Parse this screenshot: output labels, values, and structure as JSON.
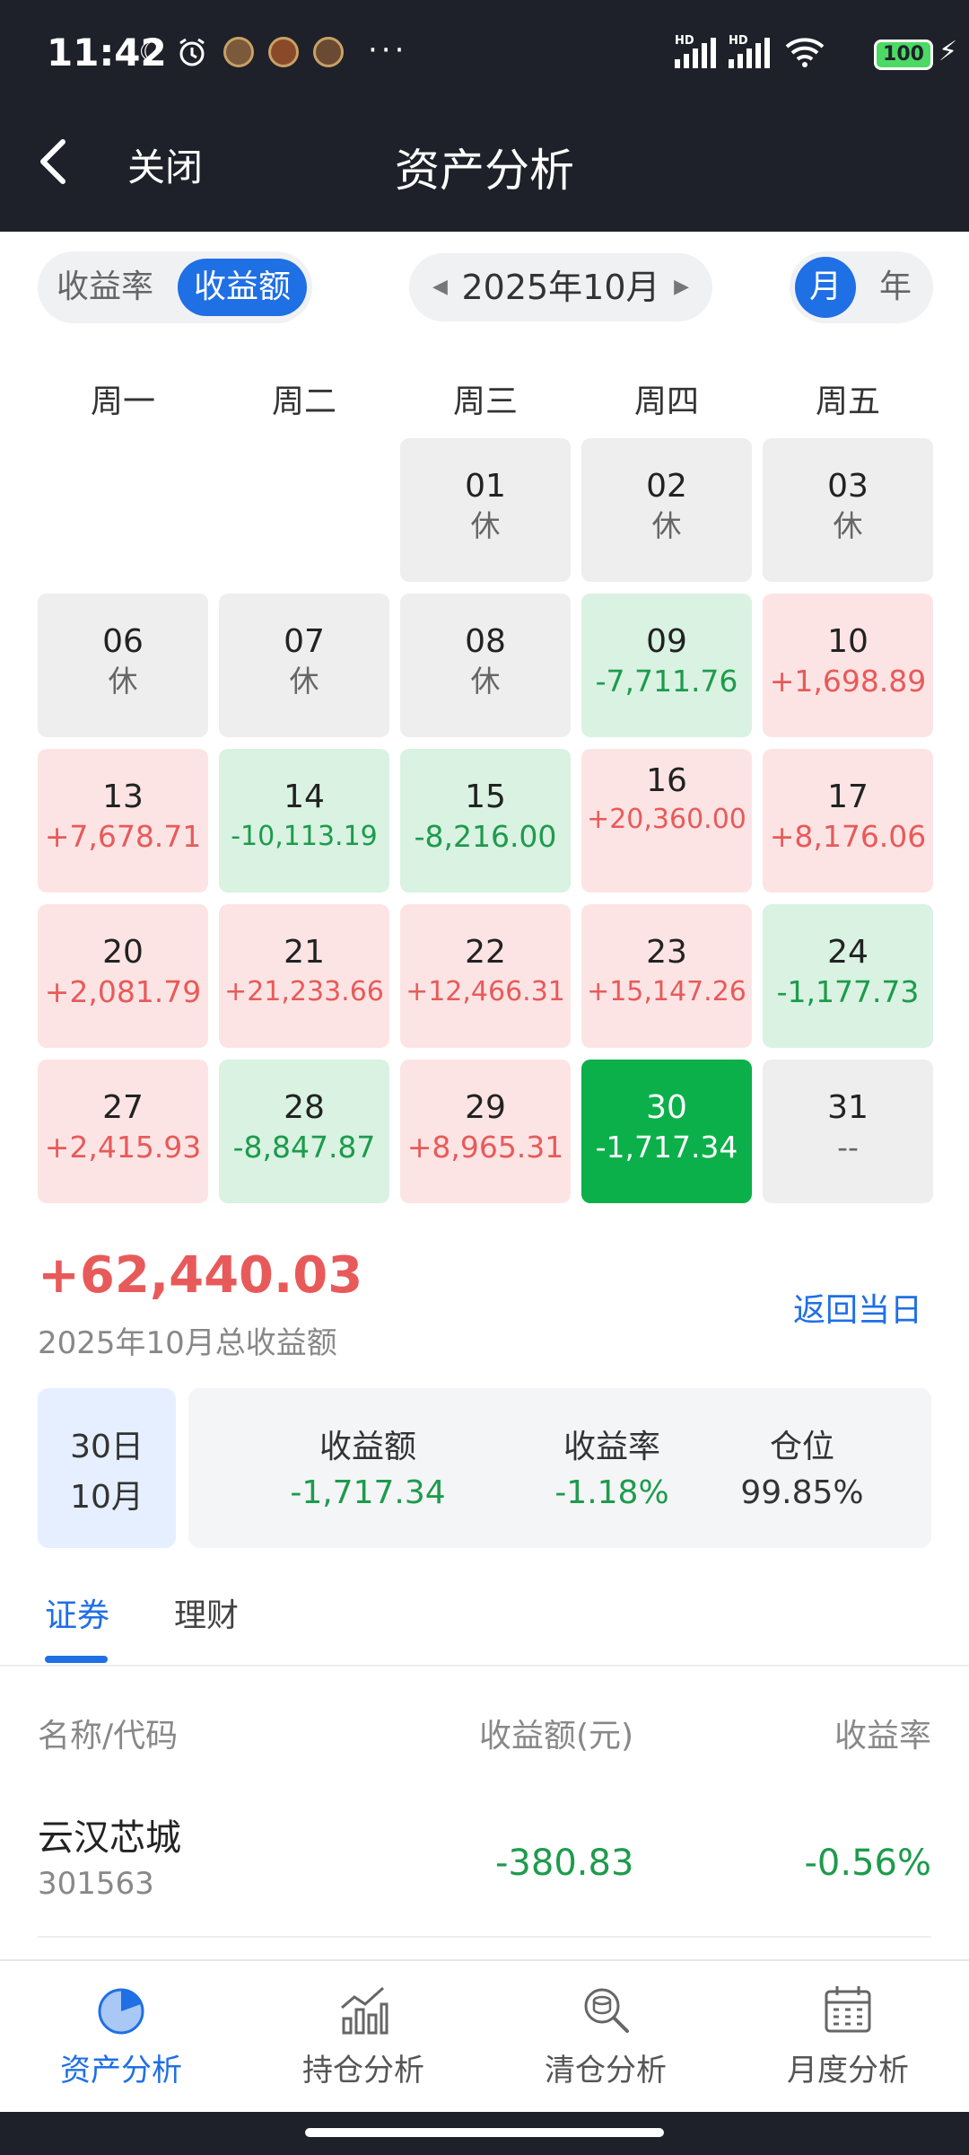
{
  "status_bar": {
    "time": "11:42",
    "battery": "100",
    "hd1": "HD",
    "hd2": "HD"
  },
  "header": {
    "close_label": "关闭",
    "title": "资产分析"
  },
  "controls": {
    "metric_tabs": [
      "收益率",
      "收益额"
    ],
    "metric_selected": "收益额",
    "month_label": "2025年10月",
    "period_tabs": [
      "月",
      "年"
    ],
    "period_selected": "月"
  },
  "calendar": {
    "weekdays": [
      "周一",
      "周二",
      "周三",
      "周四",
      "周五"
    ],
    "days": [
      {
        "day": "01",
        "value": "休",
        "state": "rest"
      },
      {
        "day": "02",
        "value": "休",
        "state": "rest"
      },
      {
        "day": "03",
        "value": "休",
        "state": "rest"
      },
      {
        "day": "06",
        "value": "休",
        "state": "rest"
      },
      {
        "day": "07",
        "value": "休",
        "state": "rest"
      },
      {
        "day": "08",
        "value": "休",
        "state": "rest"
      },
      {
        "day": "09",
        "value": "-7,711.76",
        "state": "loss"
      },
      {
        "day": "10",
        "value": "+1,698.89",
        "state": "gain"
      },
      {
        "day": "13",
        "value": "+7,678.71",
        "state": "gain"
      },
      {
        "day": "14",
        "value": "-10,113.19",
        "state": "loss"
      },
      {
        "day": "15",
        "value": "-8,216.00",
        "state": "loss"
      },
      {
        "day": "16",
        "value": "+20,360.00",
        "state": "gain"
      },
      {
        "day": "17",
        "value": "+8,176.06",
        "state": "gain"
      },
      {
        "day": "20",
        "value": "+2,081.79",
        "state": "gain"
      },
      {
        "day": "21",
        "value": "+21,233.66",
        "state": "gain"
      },
      {
        "day": "22",
        "value": "+12,466.31",
        "state": "gain"
      },
      {
        "day": "23",
        "value": "+15,147.26",
        "state": "gain"
      },
      {
        "day": "24",
        "value": "-1,177.73",
        "state": "loss"
      },
      {
        "day": "27",
        "value": "+2,415.93",
        "state": "gain"
      },
      {
        "day": "28",
        "value": "-8,847.87",
        "state": "loss"
      },
      {
        "day": "29",
        "value": "+8,965.31",
        "state": "gain"
      },
      {
        "day": "30",
        "value": "-1,717.34",
        "state": "selected"
      },
      {
        "day": "31",
        "value": "--",
        "state": "rest"
      }
    ]
  },
  "summary": {
    "total": "+62,440.03",
    "caption": "2025年10月总收益额",
    "back_today": "返回当日"
  },
  "selected_day": {
    "day": "30日",
    "month": "10月",
    "stats": [
      {
        "label": "收益额",
        "value": "-1,717.34"
      },
      {
        "label": "收益率",
        "value": "-1.18%"
      },
      {
        "label": "仓位",
        "value": "99.85%"
      }
    ]
  },
  "tabs": [
    "证券",
    "理财"
  ],
  "tab_selected": "证券",
  "list": {
    "headers": [
      "名称/代码",
      "收益额(元)",
      "收益率"
    ],
    "rows": [
      {
        "name": "云汉芯城",
        "code": "301563",
        "amount": "-380.83",
        "rate": "-0.56%"
      }
    ]
  },
  "bottom_nav": [
    {
      "label": "资产分析",
      "icon": "pie-chart-icon",
      "active": true
    },
    {
      "label": "持仓分析",
      "icon": "bar-trend-icon",
      "active": false
    },
    {
      "label": "清仓分析",
      "icon": "coin-search-icon",
      "active": false
    },
    {
      "label": "月度分析",
      "icon": "calendar-icon",
      "active": false
    }
  ],
  "colors": {
    "accent": "#1f6fe5",
    "gain": "#e85a5a",
    "loss": "#1d9b4c",
    "selected_cell": "#0bb04a",
    "header_bg": "#1e2129"
  }
}
